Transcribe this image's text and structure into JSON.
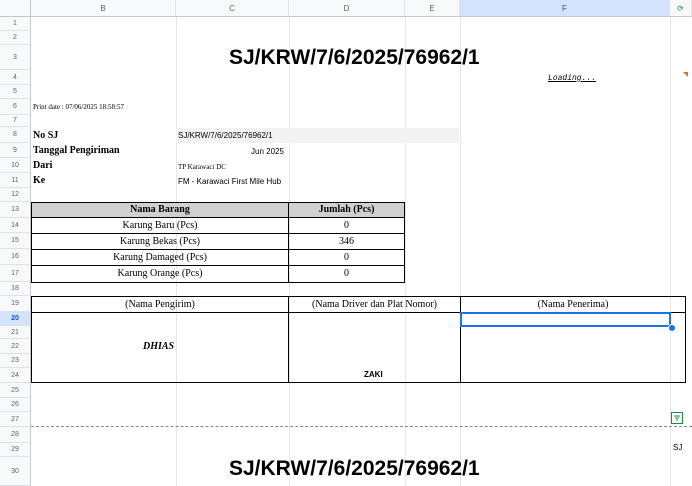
{
  "columns": [
    "B",
    "C",
    "D",
    "E",
    "F"
  ],
  "rows": [
    "1",
    "2",
    "3",
    "4",
    "5",
    "6",
    "7",
    "8",
    "9",
    "10",
    "11",
    "12",
    "13",
    "14",
    "15",
    "16",
    "17",
    "18",
    "19",
    "20",
    "21",
    "22",
    "23",
    "24",
    "25",
    "26",
    "27",
    "28",
    "29",
    "30"
  ],
  "doc": {
    "title": "SJ/KRW/7/6/2025/76962/1",
    "loading": "Loading...",
    "print_date": "Print date : 07/06/2025 18:58:57",
    "fields": [
      {
        "label": "No SJ",
        "value": "SJ/KRW/7/6/2025/76962/1"
      },
      {
        "label": "Tanggal Pengiriman",
        "value": "Jun 2025"
      },
      {
        "label": "Dari",
        "value": "TP Karawaci DC"
      },
      {
        "label": "Ke",
        "value": "FM - Karawaci First Mile Hub"
      }
    ],
    "table": {
      "headers": [
        "Nama Barang",
        "Jumlah (Pcs)"
      ],
      "rows": [
        [
          "Karung Baru (Pcs)",
          "0"
        ],
        [
          "Karung Bekas (Pcs)",
          "346"
        ],
        [
          "Karung Damaged (Pcs)",
          "0"
        ],
        [
          "Karung Orange (Pcs)",
          "0"
        ]
      ]
    },
    "signatures": {
      "headers": [
        "(Nama Pengirim)",
        "(Nama Driver dan Plat Nomor)",
        "(Nama Penerima)"
      ],
      "sender": "DHIAS",
      "driver": "ZAKI"
    },
    "second_title": "SJ/KRW/7/6/2025/76962/1",
    "right_edge_text": "SJ"
  }
}
